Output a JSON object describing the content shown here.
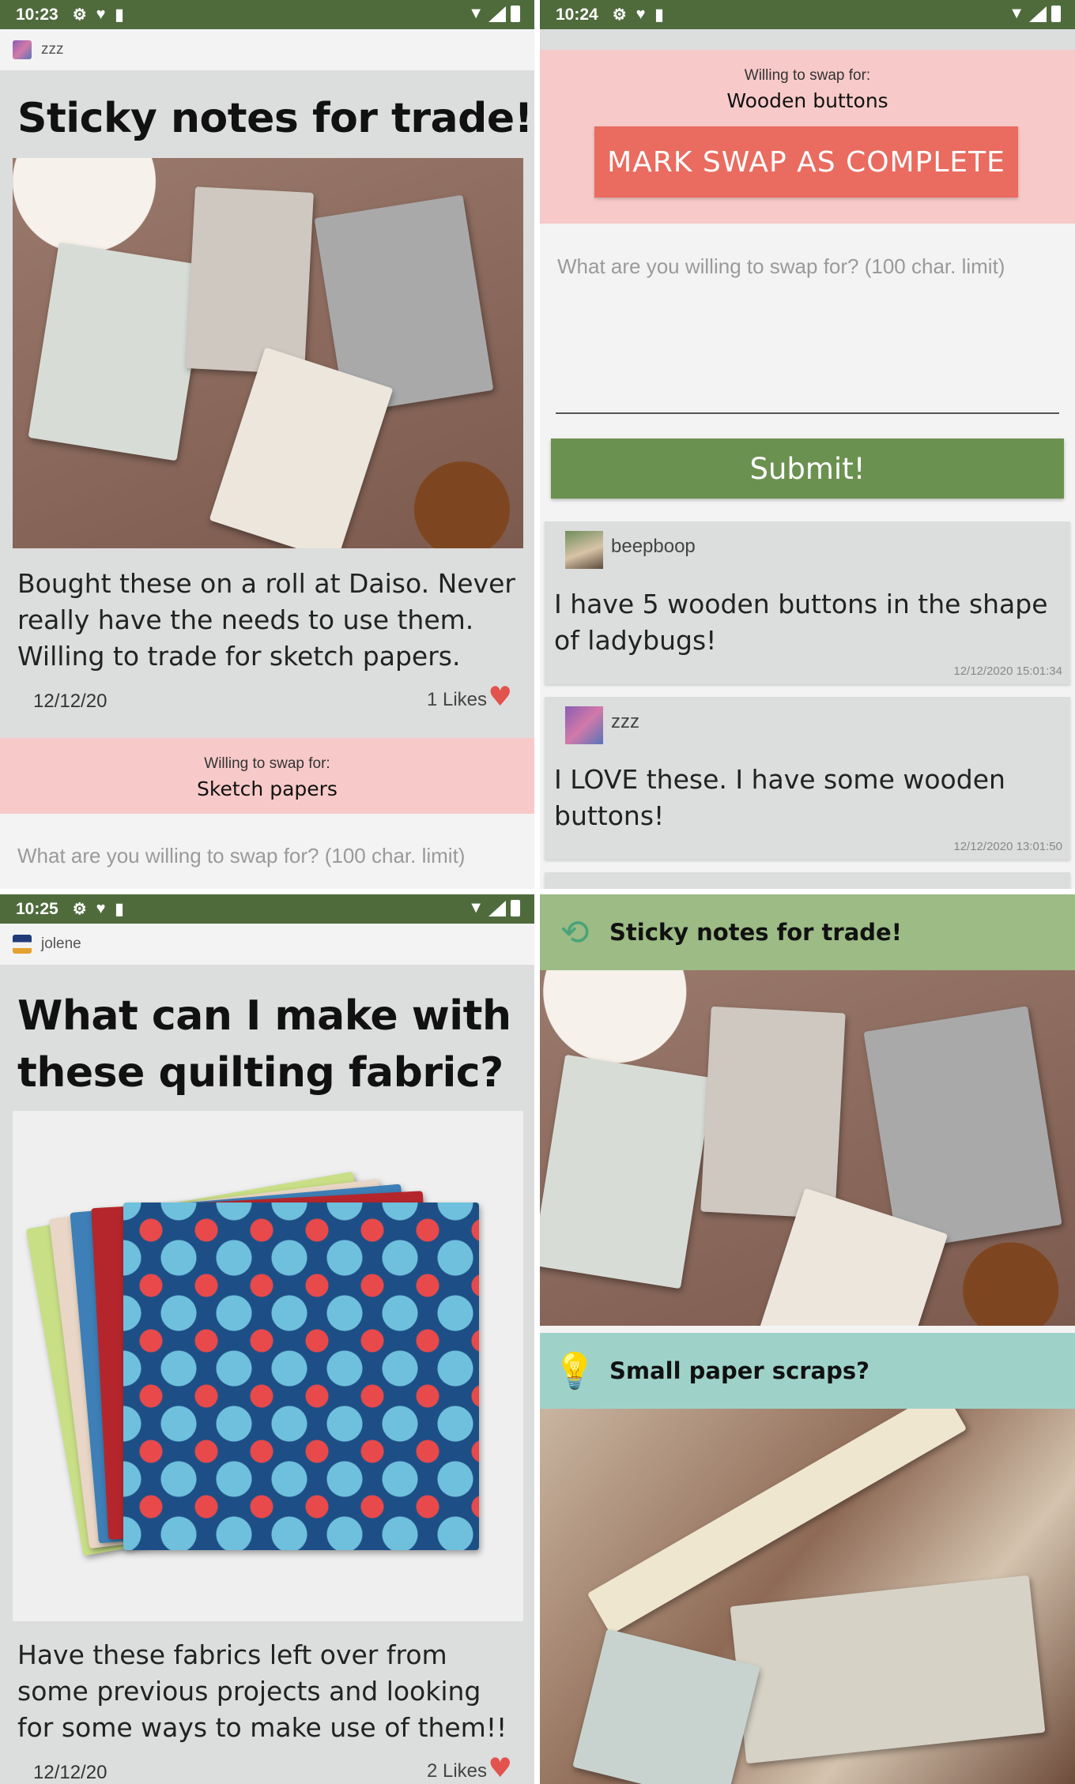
{
  "panel1": {
    "status": {
      "time": "10:23"
    },
    "username": "zzz",
    "title": "Sticky notes for trade!",
    "description": "Bought these on a roll at Daiso. Never really have the needs to use them. Willing to trade for sketch papers.",
    "date": "12/12/20",
    "likes": "1 Likes",
    "swap_label": "Willing to swap for:",
    "swap_value": "Sketch papers",
    "input_placeholder": "What are you willing to swap for? (100 char. limit)"
  },
  "panel2": {
    "status": {
      "time": "10:24"
    },
    "swap_label": "Willing to swap for:",
    "swap_value": "Wooden buttons",
    "mark_complete_label": "MARK SWAP AS COMPLETE",
    "input_placeholder": "What are you willing to swap for? (100 char. limit)",
    "submit_label": "Submit!",
    "comments": [
      {
        "user": "beepboop",
        "text": "I have 5 wooden buttons in the shape of ladybugs!",
        "time": "12/12/2020 15:01:34"
      },
      {
        "user": "zzz",
        "text": "I LOVE these. I have some wooden buttons!",
        "time": "12/12/2020 13:01:50"
      }
    ]
  },
  "panel3": {
    "status": {
      "time": "10:25"
    },
    "username": "jolene",
    "title": "What can I make with these quilting fabric?",
    "description": "Have these fabrics left over from some previous projects and looking for some ways to make use of them!!",
    "date": "12/12/20",
    "likes": "2 Likes"
  },
  "panel4": {
    "feed": [
      {
        "title": "Sticky notes for trade!",
        "icon": "swap-arrows-icon",
        "color": "#9cbb85"
      },
      {
        "title": "Small paper scraps?",
        "icon": "lightbulb-icon",
        "color": "#9ed2c9"
      }
    ]
  },
  "colors": {
    "status_bar": "#4f6b3c",
    "accent_red": "#ea6b5f",
    "submit_green": "#6b9150",
    "swap_pink": "#f7cac9",
    "heart": "#e2534e"
  }
}
